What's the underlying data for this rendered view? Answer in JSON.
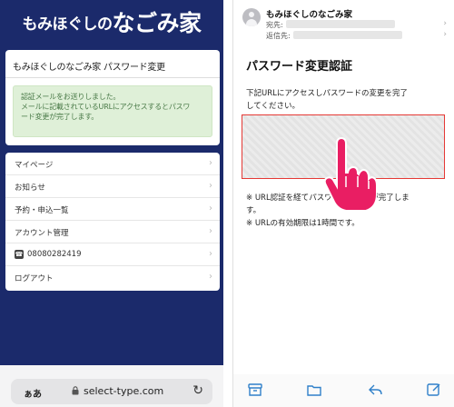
{
  "left": {
    "logo_small": "もみほぐしの",
    "logo_big": "なごみ家",
    "card_title": "もみほぐしのなごみ家 パスワード変更",
    "alert_lines": [
      "認証メールをお送りしました。",
      "メールに記載されているURLにアクセスするとパスワ",
      "ード変更が完了します。"
    ],
    "menu_items": [
      {
        "label": "マイページ"
      },
      {
        "label": "お知らせ"
      },
      {
        "label": "予約・申込一覧"
      },
      {
        "label": "アカウント管理"
      },
      {
        "label": "08080282419",
        "icon": "phone-icon"
      },
      {
        "label": "ログアウト"
      }
    ],
    "browser": {
      "aa_label": "ぁあ",
      "url": "select-type.com"
    }
  },
  "right": {
    "sender": "もみほぐしのなごみ家",
    "to_label": "宛先:",
    "reply_to_label": "返信先:",
    "mail_title": "パスワード変更認証",
    "body_lines": [
      "下記URLにアクセスしパスワードの変更を完了",
      "してください。"
    ],
    "notes": [
      "※ URL認証を経てパスワードの変更が完了しま",
      "す。",
      "※ URLの有効期限は1時間です。"
    ]
  },
  "colors": {
    "navy": "#1b2a6b",
    "alert_bg": "#dff0d8",
    "alert_text": "#4a7a48",
    "highlight_border": "#e53935",
    "finger": "#e91e63",
    "ios_blue": "#2f80c9"
  }
}
